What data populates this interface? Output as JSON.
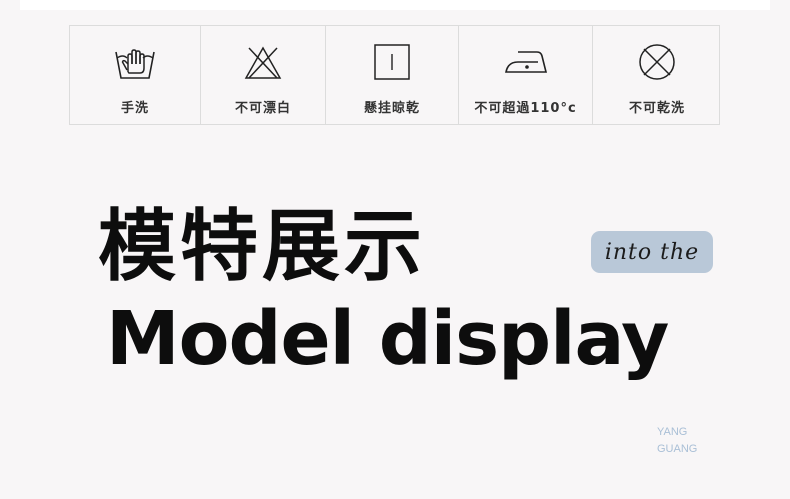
{
  "care_labels": [
    {
      "icon": "hand-wash-icon",
      "label": "手洗"
    },
    {
      "icon": "no-bleach-icon",
      "label": "不可漂白"
    },
    {
      "icon": "hang-dry-icon",
      "label": "懸挂晾乾"
    },
    {
      "icon": "iron-low-icon",
      "label": "不可超過110°c"
    },
    {
      "icon": "no-tumble-dry-icon",
      "label": "不可乾洗"
    }
  ],
  "headline": {
    "chinese": "模特展示",
    "english": "Model display"
  },
  "tag": {
    "text": "into the"
  },
  "brand": {
    "line1": "YANG",
    "line2": "GUANG"
  },
  "colors": {
    "background": "#f8f6f7",
    "tag_background": "#b9c8d8",
    "brand_text": "#a9bfd6",
    "headline_text": "#0d0d0d"
  }
}
